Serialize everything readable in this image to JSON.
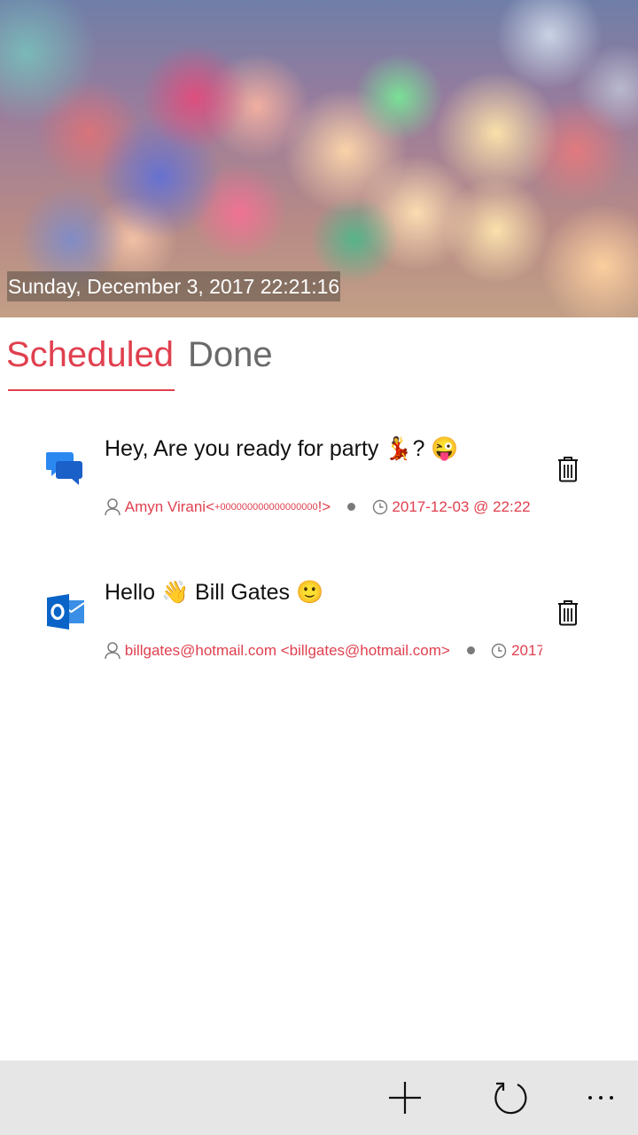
{
  "header": {
    "datetime": "Sunday, December 3, 2017 22:21:16"
  },
  "tabs": {
    "scheduled": "Scheduled",
    "done": "Done",
    "active": "Scheduled",
    "accent_color": "#e0404f"
  },
  "items": [
    {
      "app_icon": "messaging-icon",
      "title_text": "Hey, Are you ready for party",
      "title_emoji_1": "💃",
      "title_after": "?",
      "title_emoji_2": "😜",
      "recipient_name": "Amyn Virani",
      "recipient_open": " <",
      "recipient_number": "+000000000000000000",
      "recipient_close": "!>",
      "schedule": "2017-12-03 @ 22:22"
    },
    {
      "app_icon": "outlook-icon",
      "title_text": "Hello",
      "title_emoji_1": "👋",
      "title_after": "Bill Gates",
      "title_emoji_2": "🙂",
      "recipient": "billgates@hotmail.com <billgates@hotmail.com>",
      "schedule": "2017"
    }
  ],
  "appbar": {
    "add_icon": "plus-icon",
    "refresh_icon": "refresh-icon",
    "more_icon": "more-icon"
  }
}
